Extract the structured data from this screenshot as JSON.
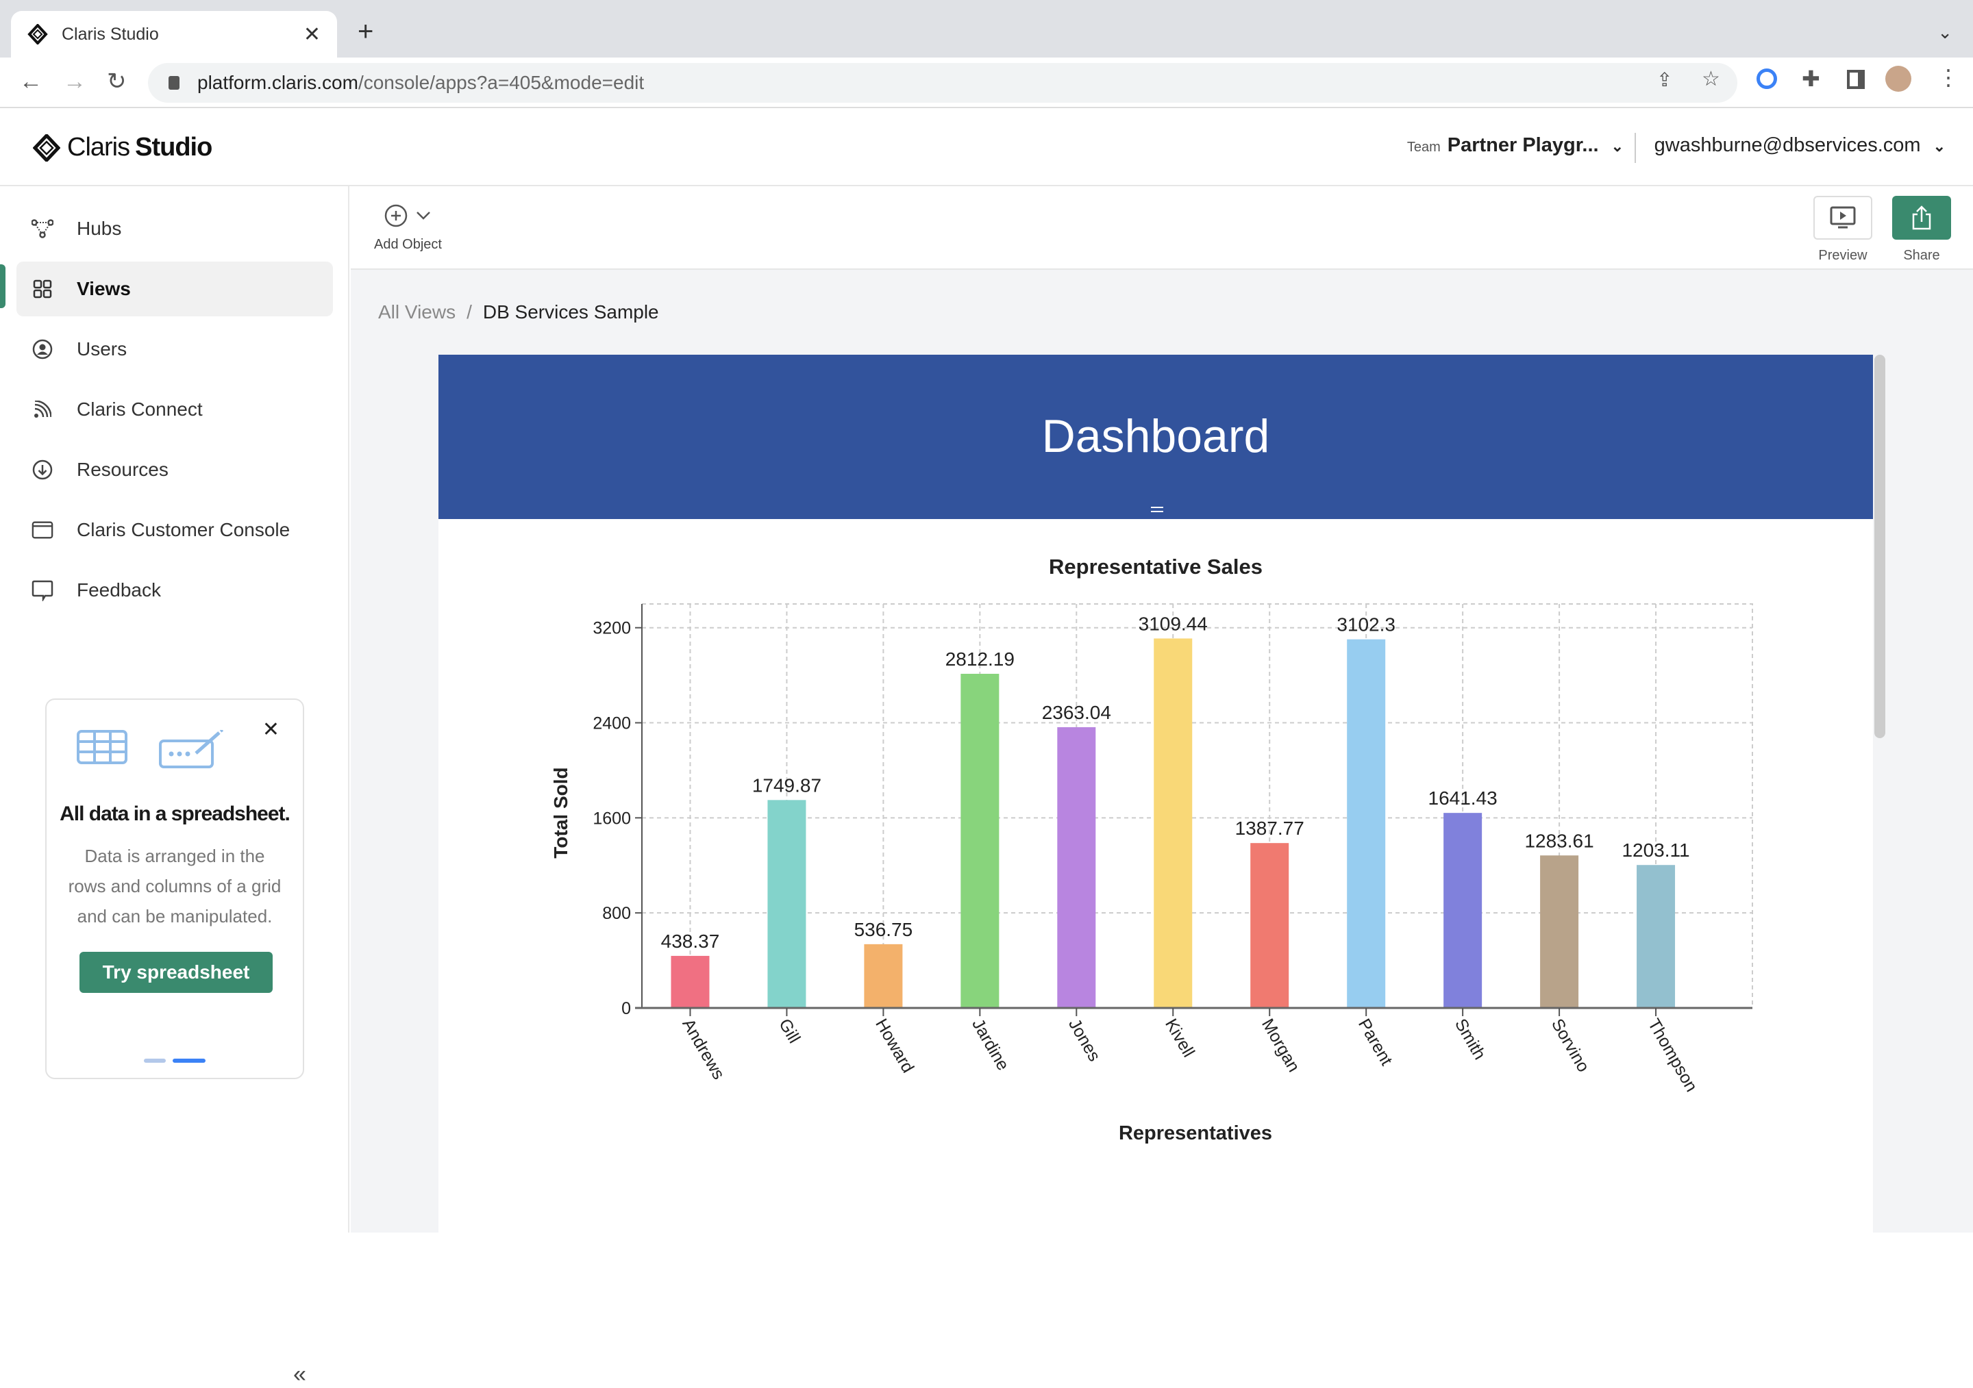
{
  "browser": {
    "tab_title": "Claris Studio",
    "url_host": "platform.claris.com",
    "url_path": "/console/apps?a=405&mode=edit"
  },
  "header": {
    "brand_light": "Claris",
    "brand_bold": "Studio",
    "team_label": "Team",
    "team_name": "Partner Playgr...",
    "account_email": "gwashburne@dbservices.com"
  },
  "sidebar": {
    "items": [
      {
        "label": "Hubs",
        "icon": "hubs-icon"
      },
      {
        "label": "Views",
        "icon": "grid-icon",
        "active": true
      },
      {
        "label": "Users",
        "icon": "user-circle-icon"
      },
      {
        "label": "Claris Connect",
        "icon": "rss-icon"
      },
      {
        "label": "Resources",
        "icon": "download-circle-icon"
      },
      {
        "label": "Claris Customer Console",
        "icon": "window-icon"
      },
      {
        "label": "Feedback",
        "icon": "chat-bubble-icon"
      }
    ],
    "promo": {
      "title": "All data in a spreadsheet.",
      "body": "Data is arranged in the rows and columns of a grid and can be manipulated.",
      "button": "Try spreadsheet",
      "page": 2,
      "pages": 2
    }
  },
  "editbar": {
    "add_object": "Add Object",
    "preview": "Preview",
    "share": "Share"
  },
  "breadcrumb": {
    "root": "All Views",
    "separator": "/",
    "current": "DB Services Sample"
  },
  "banner": {
    "title": "Dashboard",
    "color": "#32539c"
  },
  "colors": {
    "accent": "#3a8a6e"
  },
  "chart_data": {
    "type": "bar",
    "title": "Representative Sales",
    "xlabel": "Representatives",
    "ylabel": "Total Sold",
    "ylim": [
      0,
      3400
    ],
    "yticks": [
      0,
      800,
      1600,
      2400,
      3200
    ],
    "grid": true,
    "categories": [
      "Andrews",
      "Gill",
      "Howard",
      "Jardine",
      "Jones",
      "Kivell",
      "Morgan",
      "Parent",
      "Smith",
      "Sorvino",
      "Thompson"
    ],
    "values": [
      438.37,
      1749.87,
      536.75,
      2812.19,
      2363.04,
      3109.44,
      1387.77,
      3102.3,
      1641.43,
      1283.61,
      1203.11
    ],
    "value_labels": [
      "438.37",
      "1749.87",
      "536.75",
      "2812.19",
      "2363.04",
      "3109.44",
      "1387.77",
      "3102.3",
      "1641.43",
      "1283.61",
      "1203.11"
    ],
    "colors": [
      "#f07082",
      "#83d3cb",
      "#f3b16b",
      "#88d47c",
      "#b885e0",
      "#f9d877",
      "#f07a70",
      "#97cdf0",
      "#8081dc",
      "#b8a38a",
      "#93c0cf"
    ]
  }
}
